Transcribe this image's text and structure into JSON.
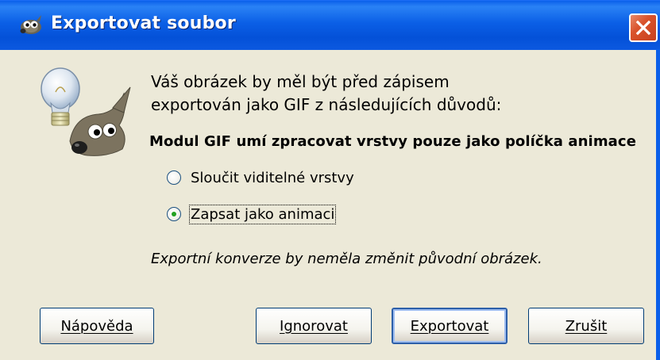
{
  "window": {
    "title": "Exportovat soubor"
  },
  "message": {
    "line1": "Váš obrázek by měl být před zápisem",
    "line2": "exportován jako GIF z následujících důvodů:"
  },
  "reason": {
    "text": "Modul GIF umí zpracovat vrstvy pouze jako políčka animace"
  },
  "options": [
    {
      "label": "Sloučit viditelné vrstvy",
      "selected": false
    },
    {
      "label": "Zapsat jako animaci",
      "selected": true
    }
  ],
  "note": {
    "text": "Exportní konverze by neměla změnit původní obrázek."
  },
  "buttons": {
    "help": "Nápověda",
    "ignore": "Ignorovat",
    "export": "Exportovat",
    "cancel": "Zrušit"
  },
  "icons": {
    "title": "gimp-wilber-icon",
    "close": "close-icon",
    "dialog": "gimp-lightbulb-mascot-icon"
  },
  "colors": {
    "titlebar": "#0B5FE6",
    "close": "#D9532C",
    "background": "#ECE9D8",
    "radio_selected": "#21A121"
  }
}
